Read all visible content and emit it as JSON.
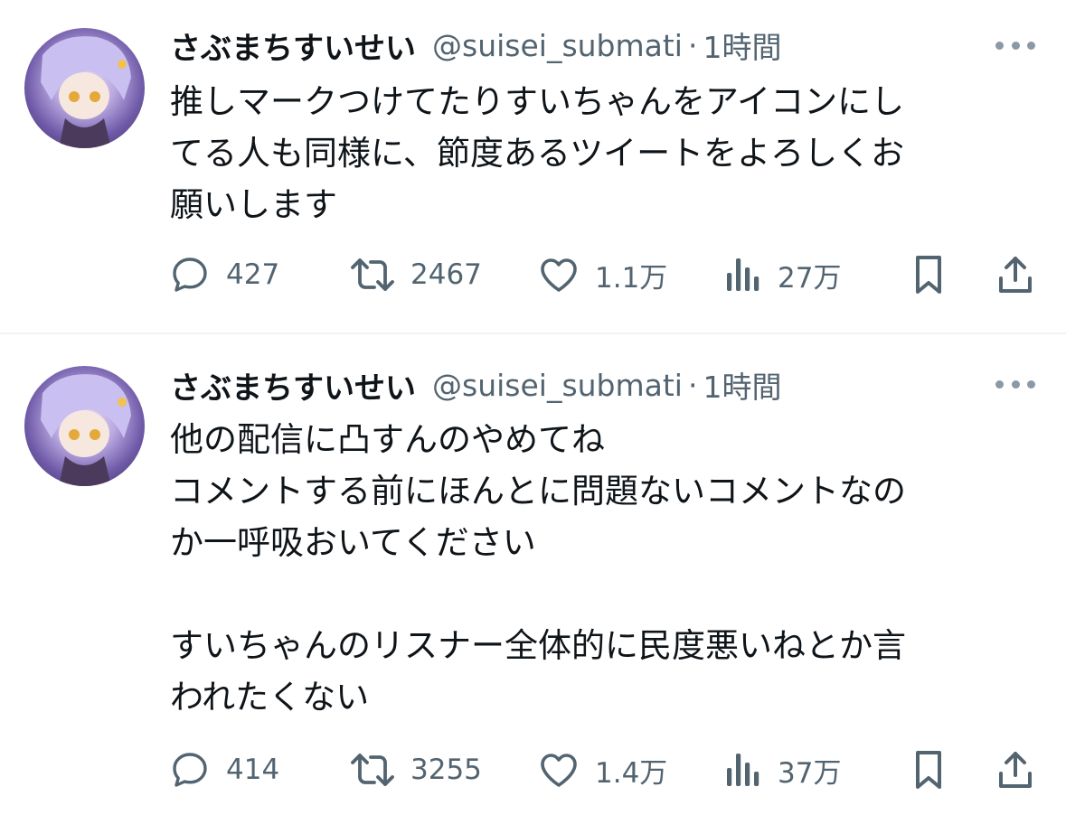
{
  "tweets": [
    {
      "display_name": "さぶまちすいせい",
      "handle": "@suisei_submati",
      "separator": "·",
      "time": "1時間",
      "text": "推しマークつけてたりすいちゃんをアイコンにし\nてる人も同様に、節度あるツイートをよろしくお\n願いします",
      "stats": {
        "replies": "427",
        "retweets": "2467",
        "likes": "1.1万",
        "views": "27万"
      }
    },
    {
      "display_name": "さぶまちすいせい",
      "handle": "@suisei_submati",
      "separator": "·",
      "time": "1時間",
      "text": "他の配信に凸すんのやめてね\nコメントする前にほんとに問題ないコメントなの\nか一呼吸おいてください\n\nすいちゃんのリスナー全体的に民度悪いねとか言\nわれたくない",
      "stats": {
        "replies": "414",
        "retweets": "3255",
        "likes": "1.4万",
        "views": "37万"
      }
    }
  ],
  "icons": [
    "more-icon",
    "reply-icon",
    "retweet-icon",
    "like-icon",
    "views-icon",
    "bookmark-icon",
    "share-icon"
  ],
  "colors": {
    "text": "#0f1419",
    "secondary": "#536471",
    "divider": "#eff3f4",
    "avatar_accent": "#b9a8e0"
  }
}
